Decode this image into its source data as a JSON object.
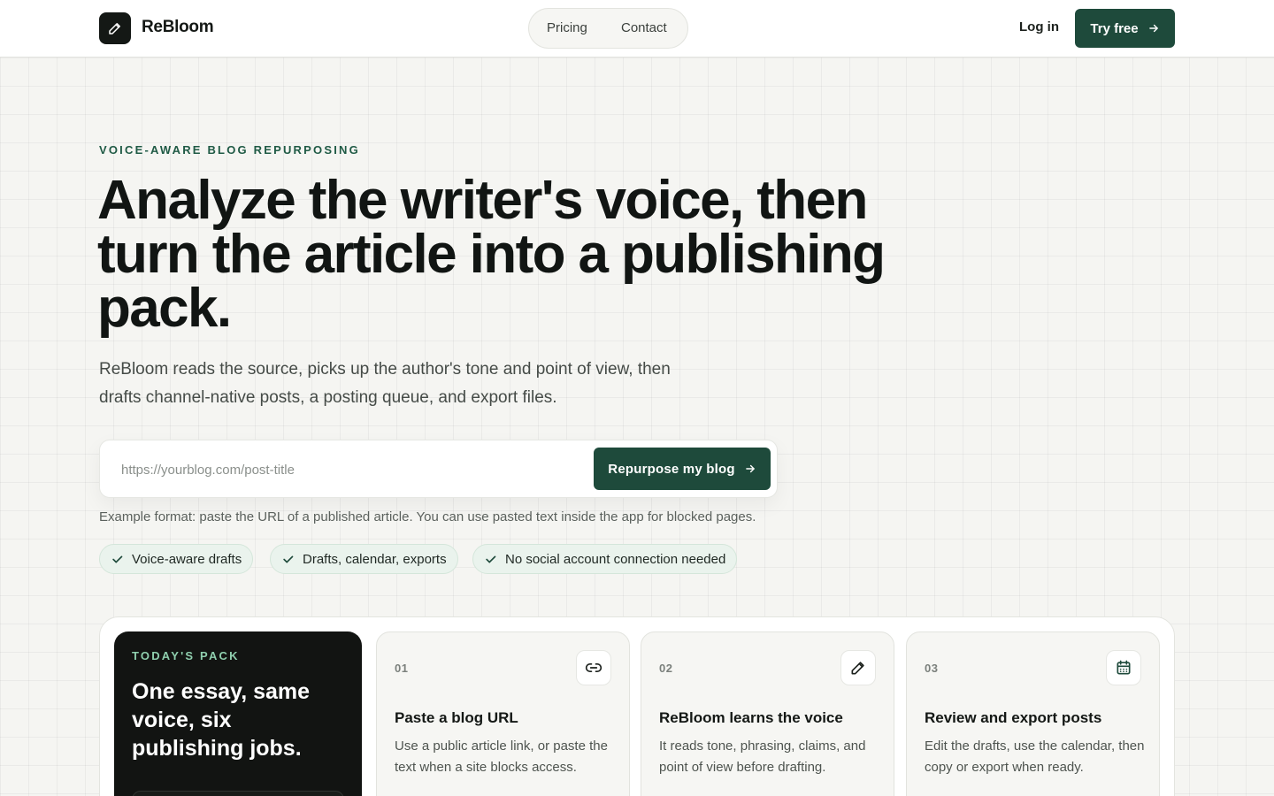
{
  "header": {
    "brand": "ReBloom",
    "logo_icon": "pen-icon",
    "nav": [
      {
        "label": "Pricing"
      },
      {
        "label": "Contact"
      }
    ],
    "login_label": "Log in",
    "cta_label": "Try free",
    "cta_icon": "arrow-right-icon"
  },
  "hero": {
    "eyebrow": "VOICE-AWARE BLOG REPURPOSING",
    "headline": "Analyze the writer's voice, then turn the article into a publishing pack.",
    "subtext": "ReBloom reads the source, picks up the author's tone and point of view, then drafts channel-native posts, a posting queue, and export files.",
    "url_input": {
      "placeholder": "https://yourblog.com/post-title",
      "value": ""
    },
    "submit_label": "Repurpose my blog",
    "hint": "Example format: paste the URL of a published article. You can use pasted text inside the app for blocked pages.",
    "chips": [
      {
        "label": "Voice-aware drafts",
        "icon": "check-icon"
      },
      {
        "label": "Drafts, calendar, exports",
        "icon": "check-icon"
      },
      {
        "label": "No social account connection needed",
        "icon": "check-icon"
      }
    ]
  },
  "pack": {
    "eyebrow": "TODAY'S PACK",
    "title": "One essay, same voice, six publishing jobs.",
    "steps": [
      {
        "num": "01",
        "icon": "link-icon",
        "title": "Paste a blog URL",
        "desc": "Use a public article link, or paste the text when a site blocks access."
      },
      {
        "num": "02",
        "icon": "pen-icon",
        "title": "ReBloom learns the voice",
        "desc": "It reads tone, phrasing, claims, and point of view before drafting."
      },
      {
        "num": "03",
        "icon": "calendar-icon",
        "title": "Review and export posts",
        "desc": "Edit the drafts, use the calendar, then copy or export when ready."
      }
    ]
  },
  "colors": {
    "accent": "#1e4a3b",
    "eyebrow": "#1f5a45",
    "chip_bg": "#eaf3ed",
    "dark_card": "#121412",
    "dark_eyebrow": "#8fcfae"
  }
}
